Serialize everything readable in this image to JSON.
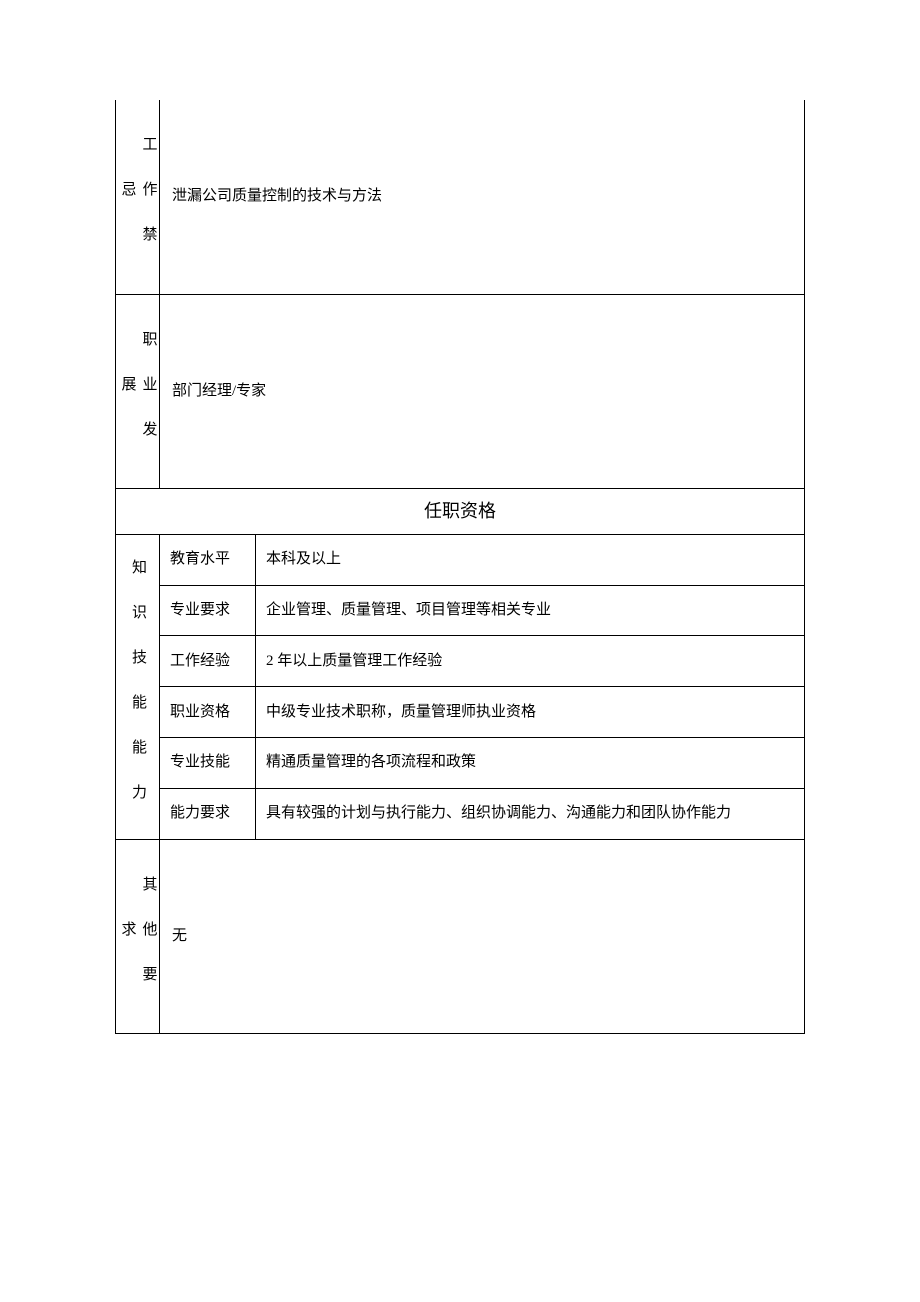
{
  "row1": {
    "label": "工作禁忌",
    "content": "泄漏公司质量控制的技术与方法"
  },
  "row2": {
    "label": "职业发展",
    "content": "部门经理/专家"
  },
  "section": "任职资格",
  "qual": {
    "label": "知识技能能力",
    "rows": [
      {
        "k": "教育水平",
        "v": "本科及以上"
      },
      {
        "k": "专业要求",
        "v": "企业管理、质量管理、项目管理等相关专业"
      },
      {
        "k": "工作经验",
        "v": "2 年以上质量管理工作经验"
      },
      {
        "k": "职业资格",
        "v": "中级专业技术职称，质量管理师执业资格"
      },
      {
        "k": "专业技能",
        "v": "精通质量管理的各项流程和政策"
      },
      {
        "k": "能力要求",
        "v": "具有较强的计划与执行能力、组织协调能力、沟通能力和团队协作能力"
      }
    ]
  },
  "other": {
    "label": "其他要求",
    "content": "无"
  }
}
